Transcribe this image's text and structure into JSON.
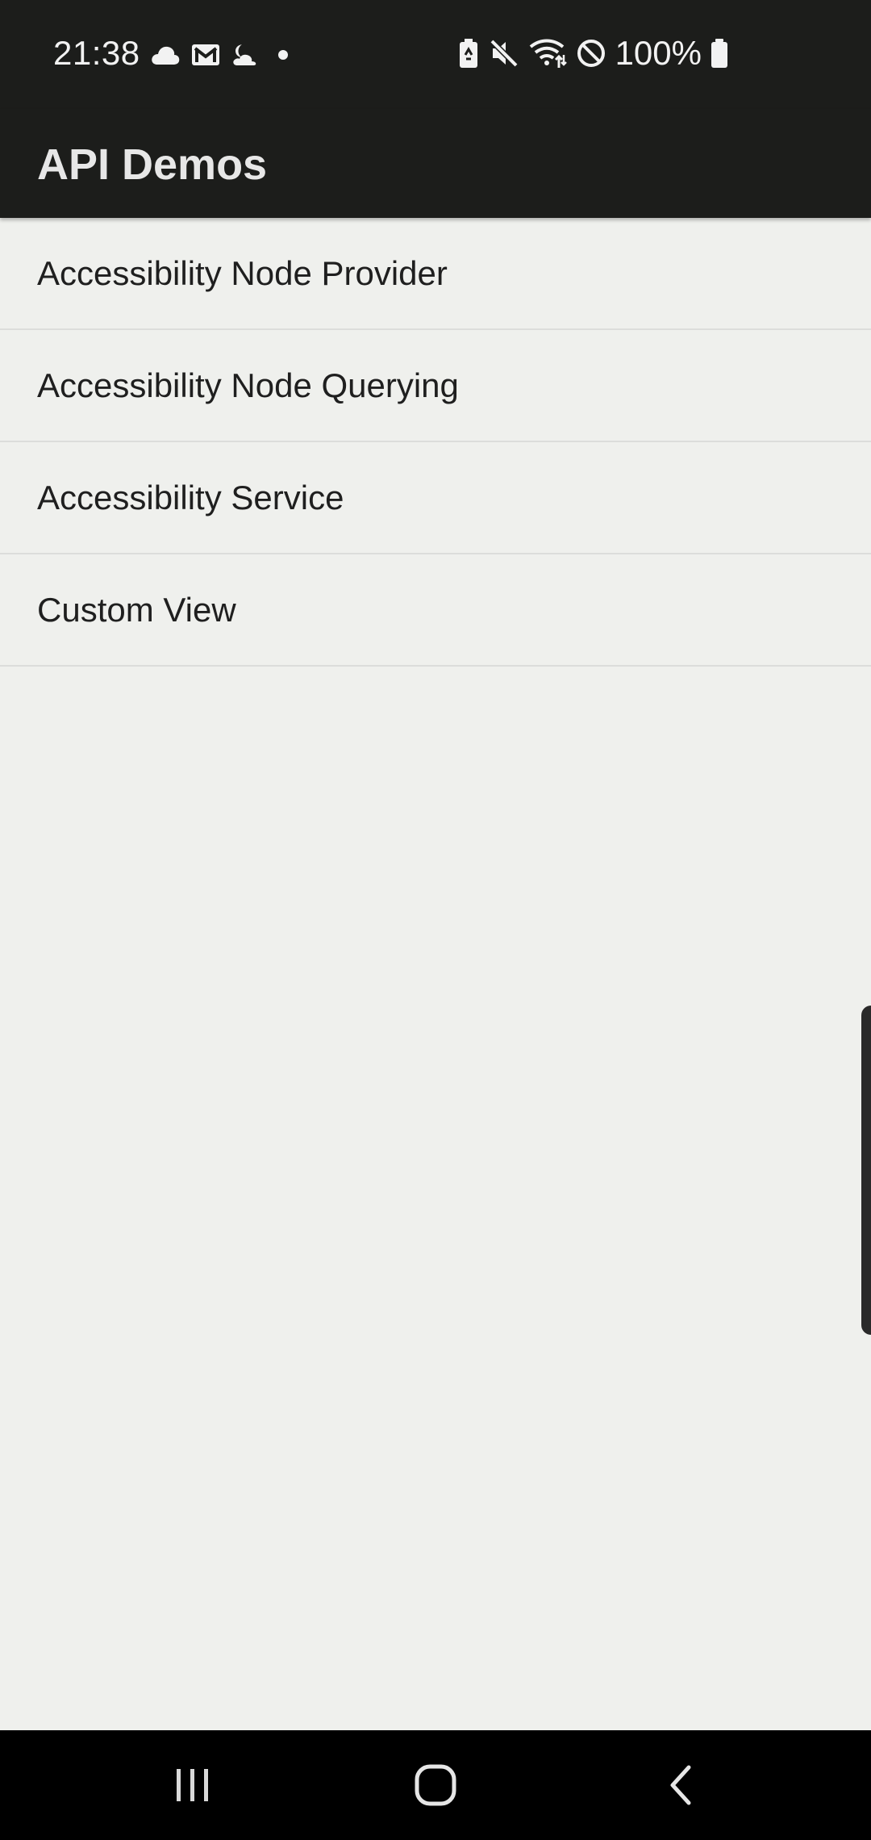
{
  "status_bar": {
    "time": "21:38",
    "battery_percent": "100%",
    "left_icons": [
      "cloud-icon",
      "gmail-icon",
      "night-mode-icon",
      "dot-icon"
    ],
    "right_icons": [
      "battery-saver-icon",
      "mute-icon",
      "wifi-icon",
      "do-not-disturb-icon",
      "battery-icon"
    ]
  },
  "app_bar": {
    "title": "API Demos"
  },
  "list": {
    "items": [
      {
        "label": "Accessibility Node Provider"
      },
      {
        "label": "Accessibility Node Querying"
      },
      {
        "label": "Accessibility Service"
      },
      {
        "label": "Custom View"
      }
    ]
  },
  "nav_bar": {
    "buttons": [
      "recent-apps-icon",
      "home-icon",
      "back-icon"
    ]
  },
  "colors": {
    "status_bar_bg": "#1c1d1b",
    "app_bar_bg": "#1c1d1b",
    "content_bg": "#eff0ed",
    "nav_bar_bg": "#000000",
    "divider": "#dcdddb"
  }
}
